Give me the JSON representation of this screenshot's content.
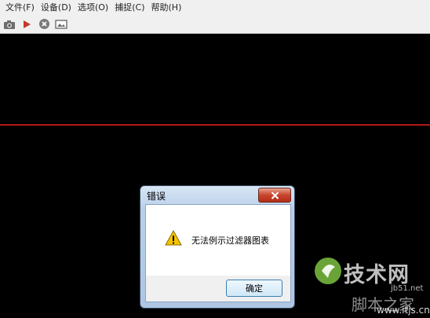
{
  "menu": {
    "items": [
      "文件(F)",
      "设备(D)",
      "选项(O)",
      "捕捉(C)",
      "帮助(H)"
    ]
  },
  "toolbar": {
    "icons": [
      "camera-icon",
      "play-icon",
      "stop-icon",
      "image-icon"
    ]
  },
  "colors": {
    "redline": "#b3181a",
    "play": "#c0392b"
  },
  "dialog": {
    "title": "错误",
    "message": "无法例示过滤器图表",
    "ok_label": "确定"
  },
  "watermark": {
    "site": "技术网",
    "url": "jb51.net",
    "bottom": "脚本之家",
    "url2": "www.itjs.cn"
  }
}
